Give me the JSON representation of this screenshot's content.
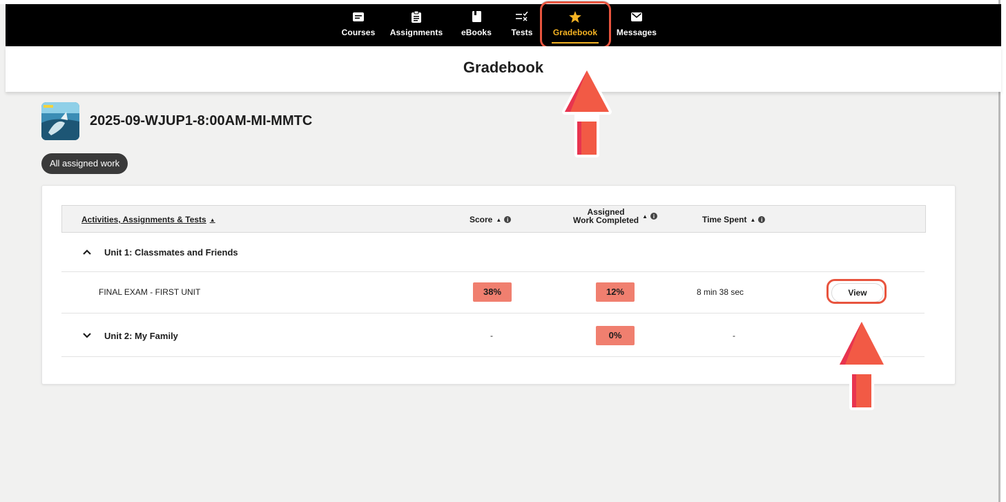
{
  "nav": {
    "items": [
      {
        "label": "Courses",
        "icon": "folder-icon"
      },
      {
        "label": "Assignments",
        "icon": "clipboard-icon"
      },
      {
        "label": "eBooks",
        "icon": "book-icon"
      },
      {
        "label": "Tests",
        "icon": "checklist-icon"
      },
      {
        "label": "Gradebook",
        "icon": "star-icon",
        "active": true
      },
      {
        "label": "Messages",
        "icon": "envelope-icon"
      }
    ],
    "active_color": "#f5b323"
  },
  "page": {
    "title": "Gradebook"
  },
  "course": {
    "title": "2025-09-WJUP1-8:00AM-MI-MMTC",
    "thumbnail_icon": "course-cover-image"
  },
  "filter": {
    "label": "All assigned work"
  },
  "table": {
    "headers": {
      "activities": "Activities, Assignments & Tests",
      "score": "Score",
      "assigned_line1": "Assigned",
      "assigned_line2": "Work Completed",
      "time": "Time Spent"
    },
    "units": [
      {
        "label": "Unit 1: Classmates and Friends",
        "expanded": true,
        "items": [
          {
            "name": "FINAL EXAM - FIRST UNIT",
            "score": "38%",
            "assigned_completed": "12%",
            "time_spent": "8 min 38 sec",
            "action": "View"
          }
        ]
      },
      {
        "label": "Unit 2: My Family",
        "expanded": false,
        "score": "-",
        "assigned_completed": "0%",
        "time_spent": "-"
      }
    ]
  },
  "colors": {
    "highlight": "#e8543e",
    "badge": "#f07f6f",
    "arrow": "#f25a45"
  }
}
